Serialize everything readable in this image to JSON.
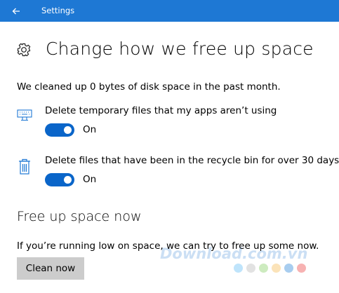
{
  "window": {
    "title": "Settings",
    "accent_color": "#1e78d4"
  },
  "page": {
    "title": "Change how we free up space",
    "icon": "gear-icon",
    "summary": "We cleaned up 0 bytes of disk space in the past month."
  },
  "options": [
    {
      "icon": "keyboard-icon",
      "label": "Delete temporary files that my apps aren’t using",
      "toggle_on": true,
      "state_label": "On"
    },
    {
      "icon": "recycle-bin-icon",
      "label": "Delete files that have been in the recycle bin for over 30 days",
      "toggle_on": true,
      "state_label": "On"
    }
  ],
  "free_up": {
    "title": "Free up space now",
    "description": "If you’re running low on space, we can try to free up some now.",
    "button_label": "Clean now"
  },
  "watermark": {
    "text": "Download.com.vn",
    "dot_colors": [
      "#bfe4fb",
      "#e2e2e2",
      "#cdebbf",
      "#fbe3b9",
      "#a8cdef",
      "#f7b2b2"
    ]
  }
}
